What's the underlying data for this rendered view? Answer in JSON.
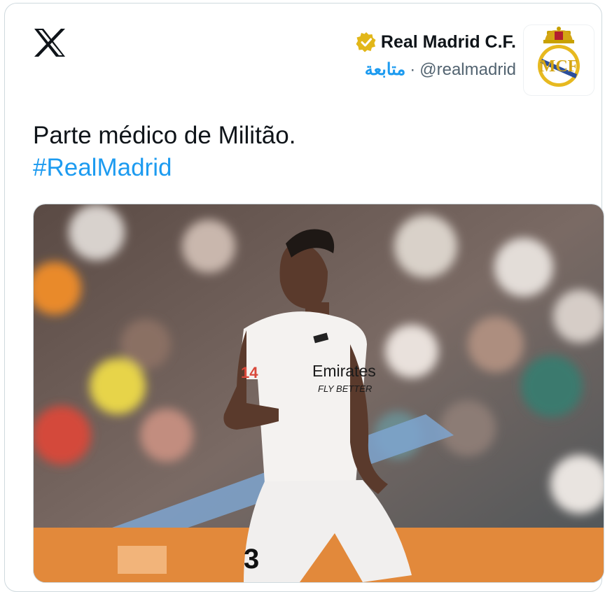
{
  "brand": {
    "logo_icon": "x-logo-icon"
  },
  "author": {
    "display_name": "Real Madrid C.F.",
    "handle": "@realmadrid",
    "separator": "·",
    "follow_label": "متابعة",
    "verified_icon": "verified-gold-badge-icon",
    "avatar_icon": "real-madrid-crest-icon"
  },
  "tweet": {
    "text": "Parte médico de Militão.",
    "hashtag": "#RealMadrid"
  },
  "media": {
    "type": "photo",
    "jersey_sponsor_line1": "Emirates",
    "jersey_sponsor_line2": "FLY BETTER",
    "jersey_number": "3",
    "sleeve_number": "14"
  },
  "colors": {
    "link": "#1d9bf0",
    "text": "#0f1419",
    "muted": "#536471",
    "verified_gold": "#e2b719",
    "border": "#cfd9de"
  }
}
